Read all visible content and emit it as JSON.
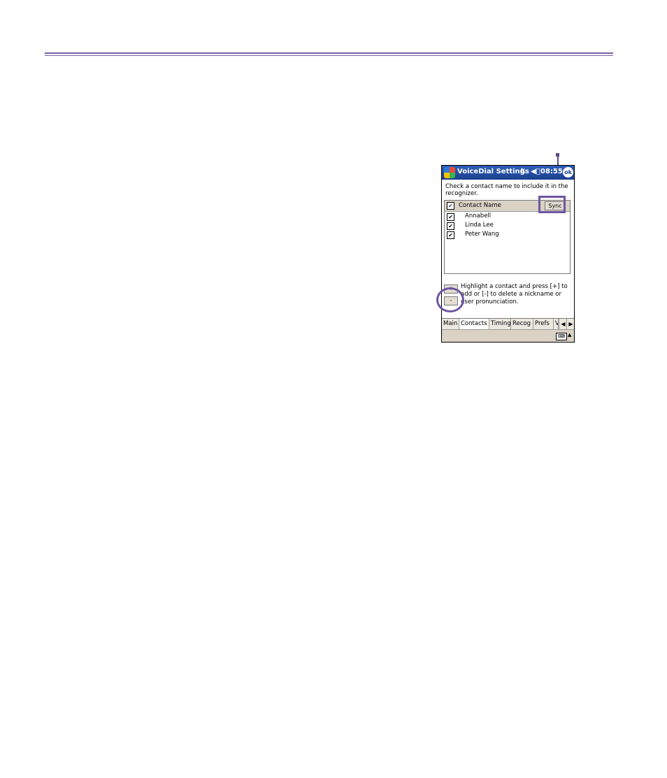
{
  "window": {
    "title": "VoiceDial Settings",
    "time": "08:55",
    "ok_label": "ok"
  },
  "instruction": "Check a contact name to include it in the recognizer.",
  "list": {
    "header_label": "Contact Name",
    "header_checked": true,
    "sync_label": "Sync",
    "contacts": [
      {
        "name": "Annabell",
        "checked": true
      },
      {
        "name": "Linda Lee",
        "checked": true
      },
      {
        "name": "Peter Wang",
        "checked": true
      }
    ]
  },
  "controls": {
    "add_label": "+",
    "remove_label": "-",
    "help_text": "Highlight a contact and press [+] to add or [-] to delete a nickname or user pronunciation."
  },
  "tabs": [
    "Main",
    "Contacts",
    "Timing",
    "Recog",
    "Prefs",
    "V"
  ],
  "active_tab": "Contacts",
  "colors": {
    "accent": "#6d55a2",
    "titlebar": "#1c3f8f"
  }
}
